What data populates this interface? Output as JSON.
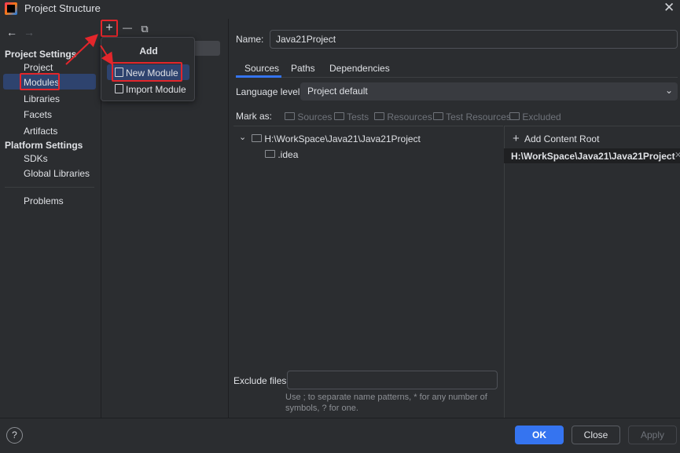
{
  "window": {
    "title": "Project Structure",
    "close_glyph": "✕"
  },
  "nav": {
    "back": "←",
    "forward": "→"
  },
  "sidebar": {
    "project_settings_header": "Project Settings",
    "project_settings": [
      "Project",
      "Modules",
      "Libraries",
      "Facets",
      "Artifacts"
    ],
    "platform_settings_header": "Platform Settings",
    "platform_settings": [
      "SDKs",
      "Global Libraries"
    ],
    "problems": "Problems",
    "selected": "Modules"
  },
  "toolbar": {
    "add": "+",
    "remove": "—",
    "copy": "⧉"
  },
  "add_popup": {
    "title": "Add",
    "items": [
      "New Module",
      "Import Module"
    ],
    "selected": "New Module"
  },
  "module": {
    "name_label": "Name:",
    "name_value": "Java21Project",
    "tabs": [
      "Sources",
      "Paths",
      "Dependencies"
    ],
    "active_tab": "Sources",
    "language_level_label": "Language level:",
    "language_level_value": "Project default",
    "mark_as_label": "Mark as:",
    "mark_as": [
      "Sources",
      "Tests",
      "Resources",
      "Test Resources",
      "Excluded"
    ],
    "tree": {
      "root": "H:\\WorkSpace\\Java21\\Java21Project",
      "children": [
        ".idea"
      ]
    },
    "add_content_root": "Add Content Root",
    "content_root": "H:\\WorkSpace\\Java21\\Java21Project",
    "exclude_files_label": "Exclude files:",
    "exclude_files_value": "",
    "exclude_hint": "Use ; to separate name patterns, * for any number of symbols, ? for one."
  },
  "buttons": {
    "help": "?",
    "ok": "OK",
    "close": "Close",
    "apply": "Apply"
  },
  "colors": {
    "background": "#2b2d30",
    "selection": "#2e436e",
    "accent": "#3574f0",
    "annotation_red": "#e3262b"
  }
}
